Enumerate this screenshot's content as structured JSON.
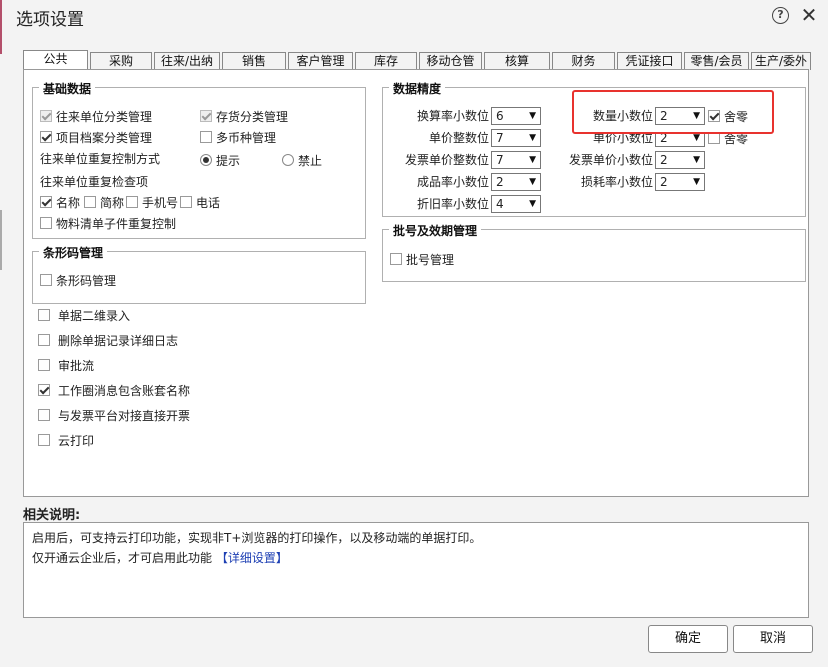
{
  "window": {
    "title": "选项设置"
  },
  "tabs": [
    {
      "label": "公共",
      "active": true
    },
    {
      "label": "采购"
    },
    {
      "label": "往来/出纳"
    },
    {
      "label": "销售"
    },
    {
      "label": "客户管理"
    },
    {
      "label": "库存"
    },
    {
      "label": "移动仓管"
    },
    {
      "label": "核算"
    },
    {
      "label": "财务"
    },
    {
      "label": "凭证接口"
    },
    {
      "label": "零售/会员"
    },
    {
      "label": "生产/委外"
    }
  ],
  "basic": {
    "title": "基础数据",
    "partner_category": "往来单位分类管理",
    "inventory_category": "存货分类管理",
    "project_archive": "项目档案分类管理",
    "multi_currency": "多币种管理",
    "dup_control_label": "往来单位重复控制方式",
    "radio_prompt": "提示",
    "radio_forbid": "禁止",
    "dup_check_label": "往来单位重复检查项",
    "check_name": "名称",
    "check_short": "简称",
    "check_phone": "手机号",
    "check_tel": "电话",
    "bom_dup": "物料清单子件重复控制"
  },
  "barcode": {
    "title": "条形码管理",
    "option": "条形码管理"
  },
  "standalone": {
    "two_dim": "单据二维录入",
    "delete_log": "删除单据记录详细日志",
    "approval": "审批流",
    "workcircle": "工作圈消息包含账套名称",
    "invoice": "与发票平台对接直接开票",
    "cloud_print": "云打印"
  },
  "precision": {
    "title": "数据精度",
    "conv_rate": {
      "label": "换算率小数位",
      "value": "6"
    },
    "unit_price_int": {
      "label": "单价整数位",
      "value": "7"
    },
    "invoice_price_int": {
      "label": "发票单价整数位",
      "value": "7"
    },
    "finished_rate": {
      "label": "成品率小数位",
      "value": "2"
    },
    "depr_rate": {
      "label": "折旧率小数位",
      "value": "4"
    },
    "qty_dec": {
      "label": "数量小数位",
      "value": "2",
      "round_label": "舍零"
    },
    "price_dec": {
      "label": "单价小数位",
      "value": "2",
      "round_label": "舍零"
    },
    "invoice_price_dec": {
      "label": "发票单价小数位",
      "value": "2"
    },
    "loss_rate": {
      "label": "损耗率小数位",
      "value": "2"
    }
  },
  "batch": {
    "title": "批号及效期管理",
    "option": "批号管理"
  },
  "description": {
    "label": "相关说明:",
    "line1": "启用后，可支持云打印功能，实现非T+浏览器的打印操作，以及移动端的单据打印。",
    "line2": "仅开通云企业后，才可启用此功能",
    "link": "【详细设置】"
  },
  "buttons": {
    "ok": "确定",
    "cancel": "取消"
  },
  "colors": {
    "highlight": "#e8322e",
    "link": "#1d3fb3"
  }
}
